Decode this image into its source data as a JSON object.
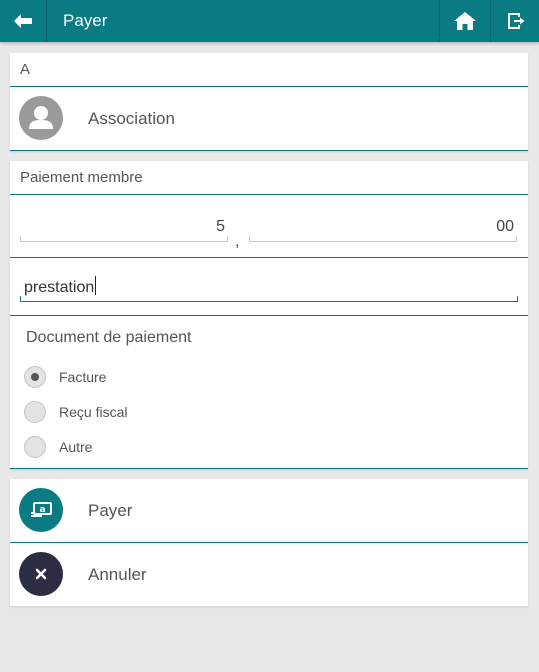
{
  "header": {
    "title": "Payer",
    "back_icon": "arrow-left-icon",
    "home_icon": "home-icon",
    "exit_icon": "exit-icon"
  },
  "recipient": {
    "section_label": "A",
    "name": "Association",
    "avatar_icon": "person-avatar-icon"
  },
  "payment": {
    "section_label": "Paiement membre",
    "amount_units": "5",
    "decimal_separator": ",",
    "amount_cents": "00",
    "description_value": "prestation",
    "document_title": "Document de paiement",
    "document_options": [
      {
        "label": "Facture",
        "selected": true
      },
      {
        "label": "Reçu fiscal",
        "selected": false
      },
      {
        "label": "Autre",
        "selected": false
      }
    ]
  },
  "actions": {
    "pay_label": "Payer",
    "pay_icon": "cash-icon",
    "cancel_label": "Annuler",
    "cancel_icon": "close-icon"
  },
  "colors": {
    "accent": "#0a7b83",
    "cancel_circle": "#2c2c44",
    "background": "#e8e8e8"
  }
}
